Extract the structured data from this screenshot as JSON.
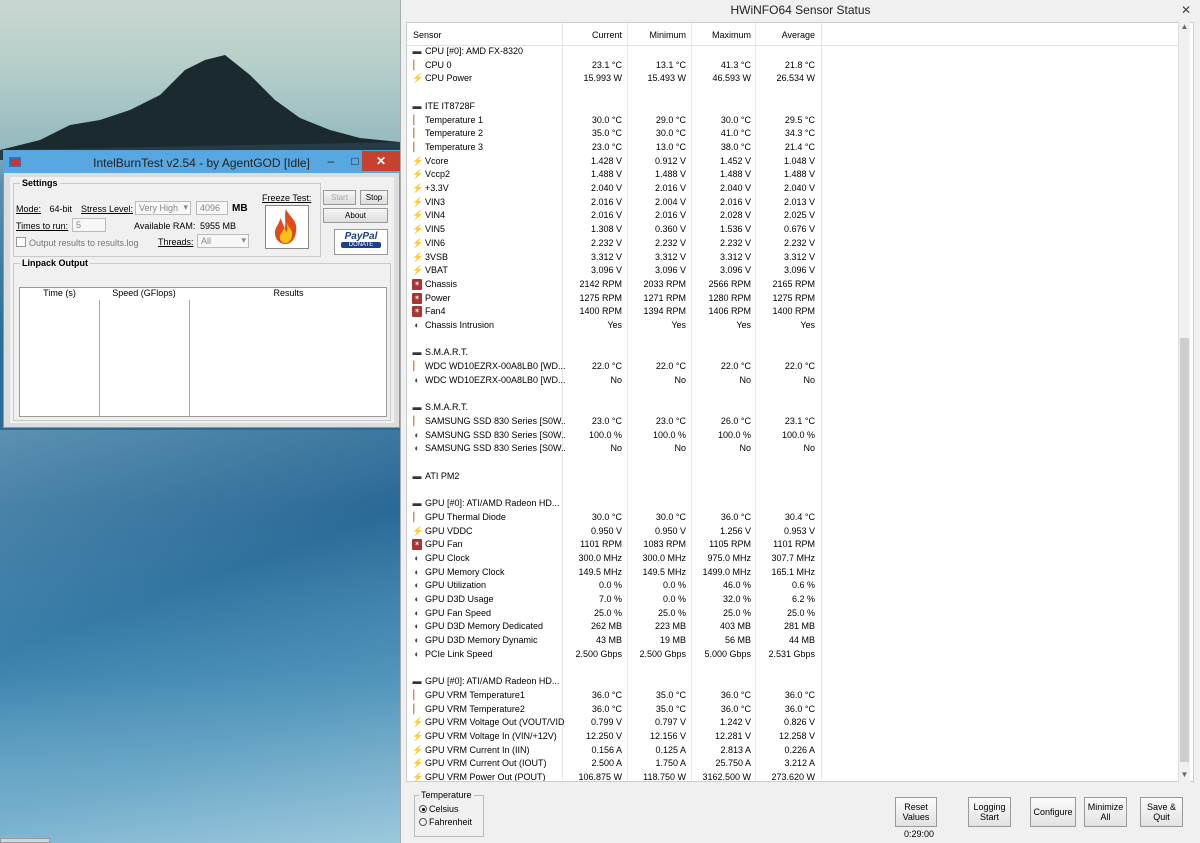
{
  "ibt": {
    "title": "IntelBurnTest v2.54 - by AgentGOD [Idle]",
    "win_min": "–",
    "win_max": "□",
    "win_close": "✕",
    "settings_title": "Settings",
    "mode_label": "Mode:",
    "mode_value": "64-bit",
    "stress_label": "Stress Level:",
    "stress_value": "Very High",
    "mb_value": "4096",
    "mb_unit": "MB",
    "times_label": "Times to run:",
    "times_value": "5",
    "ram_label": "Available RAM:",
    "ram_value": "5955 MB",
    "threads_label": "Threads:",
    "threads_value": "All",
    "log_label": "Output results to results.log",
    "freeze_label": "Freeze Test:",
    "start_label": "Start",
    "stop_label": "Stop",
    "about_label": "About",
    "paypal_label": "PayPal",
    "donate_label": "DONATE",
    "linpack_title": "Linpack Output",
    "col_time": "Time (s)",
    "col_speed": "Speed (GFlops)",
    "col_results": "Results"
  },
  "hw": {
    "title": "HWiNFO64 Sensor Status",
    "close": "✕",
    "headers": {
      "sensor": "Sensor",
      "current": "Current",
      "minimum": "Minimum",
      "maximum": "Maximum",
      "average": "Average"
    },
    "rows": [
      {
        "icon": "grp",
        "name": "CPU [#0]: AMD FX-8320"
      },
      {
        "icon": "temp",
        "name": "CPU 0",
        "cur": "23.1 °C",
        "min": "13.1 °C",
        "max": "41.3 °C",
        "avg": "21.8 °C"
      },
      {
        "icon": "volt",
        "name": "CPU Power",
        "cur": "15.993 W",
        "min": "15.493 W",
        "max": "46.593 W",
        "avg": "26.534 W"
      },
      {
        "icon": "blank",
        "name": ""
      },
      {
        "icon": "grp",
        "name": "ITE IT8728F"
      },
      {
        "icon": "temp",
        "name": "Temperature 1",
        "cur": "30.0 °C",
        "min": "29.0 °C",
        "max": "30.0 °C",
        "avg": "29.5 °C"
      },
      {
        "icon": "temp",
        "name": "Temperature 2",
        "cur": "35.0 °C",
        "min": "30.0 °C",
        "max": "41.0 °C",
        "avg": "34.3 °C"
      },
      {
        "icon": "temp",
        "name": "Temperature 3",
        "cur": "23.0 °C",
        "min": "13.0 °C",
        "max": "38.0 °C",
        "avg": "21.4 °C"
      },
      {
        "icon": "volt",
        "name": "Vcore",
        "cur": "1.428 V",
        "min": "0.912 V",
        "max": "1.452 V",
        "avg": "1.048 V"
      },
      {
        "icon": "volt",
        "name": "Vccp2",
        "cur": "1.488 V",
        "min": "1.488 V",
        "max": "1.488 V",
        "avg": "1.488 V"
      },
      {
        "icon": "volt",
        "name": "+3.3V",
        "cur": "2.040 V",
        "min": "2.016 V",
        "max": "2.040 V",
        "avg": "2.040 V"
      },
      {
        "icon": "volt",
        "name": "VIN3",
        "cur": "2.016 V",
        "min": "2.004 V",
        "max": "2.016 V",
        "avg": "2.013 V"
      },
      {
        "icon": "volt",
        "name": "VIN4",
        "cur": "2.016 V",
        "min": "2.016 V",
        "max": "2.028 V",
        "avg": "2.025 V"
      },
      {
        "icon": "volt",
        "name": "VIN5",
        "cur": "1.308 V",
        "min": "0.360 V",
        "max": "1.536 V",
        "avg": "0.676 V"
      },
      {
        "icon": "volt",
        "name": "VIN6",
        "cur": "2.232 V",
        "min": "2.232 V",
        "max": "2.232 V",
        "avg": "2.232 V"
      },
      {
        "icon": "volt",
        "name": "3VSB",
        "cur": "3.312 V",
        "min": "3.312 V",
        "max": "3.312 V",
        "avg": "3.312 V"
      },
      {
        "icon": "volt",
        "name": "VBAT",
        "cur": "3.096 V",
        "min": "3.096 V",
        "max": "3.096 V",
        "avg": "3.096 V"
      },
      {
        "icon": "fan",
        "name": "Chassis",
        "cur": "2142 RPM",
        "min": "2033 RPM",
        "max": "2566 RPM",
        "avg": "2165 RPM"
      },
      {
        "icon": "fan",
        "name": "Power",
        "cur": "1275 RPM",
        "min": "1271 RPM",
        "max": "1280 RPM",
        "avg": "1275 RPM"
      },
      {
        "icon": "fan",
        "name": "Fan4",
        "cur": "1400 RPM",
        "min": "1394 RPM",
        "max": "1406 RPM",
        "avg": "1400 RPM"
      },
      {
        "icon": "gen",
        "name": "Chassis Intrusion",
        "cur": "Yes",
        "min": "Yes",
        "max": "Yes",
        "avg": "Yes"
      },
      {
        "icon": "blank",
        "name": ""
      },
      {
        "icon": "grp",
        "name": "S.M.A.R.T."
      },
      {
        "icon": "temp",
        "name": "WDC WD10EZRX-00A8LB0 [WD...",
        "cur": "22.0 °C",
        "min": "22.0 °C",
        "max": "22.0 °C",
        "avg": "22.0 °C"
      },
      {
        "icon": "gen",
        "name": "WDC WD10EZRX-00A8LB0 [WD...",
        "cur": "No",
        "min": "No",
        "max": "No",
        "avg": "No"
      },
      {
        "icon": "blank",
        "name": ""
      },
      {
        "icon": "grp",
        "name": "S.M.A.R.T."
      },
      {
        "icon": "temp",
        "name": "SAMSUNG SSD 830 Series [S0W...",
        "cur": "23.0 °C",
        "min": "23.0 °C",
        "max": "26.0 °C",
        "avg": "23.1 °C"
      },
      {
        "icon": "gen",
        "name": "SAMSUNG SSD 830 Series [S0W...",
        "cur": "100.0 %",
        "min": "100.0 %",
        "max": "100.0 %",
        "avg": "100.0 %"
      },
      {
        "icon": "gen",
        "name": "SAMSUNG SSD 830 Series [S0W...",
        "cur": "No",
        "min": "No",
        "max": "No",
        "avg": "No"
      },
      {
        "icon": "blank",
        "name": ""
      },
      {
        "icon": "grp",
        "name": "ATI PM2"
      },
      {
        "icon": "blank",
        "name": ""
      },
      {
        "icon": "grp",
        "name": "GPU [#0]: ATI/AMD Radeon HD..."
      },
      {
        "icon": "temp",
        "name": "GPU Thermal Diode",
        "cur": "30.0 °C",
        "min": "30.0 °C",
        "max": "36.0 °C",
        "avg": "30.4 °C"
      },
      {
        "icon": "volt",
        "name": "GPU VDDC",
        "cur": "0.950 V",
        "min": "0.950 V",
        "max": "1.256 V",
        "avg": "0.953 V"
      },
      {
        "icon": "fan",
        "name": "GPU Fan",
        "cur": "1101 RPM",
        "min": "1083 RPM",
        "max": "1105 RPM",
        "avg": "1101 RPM"
      },
      {
        "icon": "gen",
        "name": "GPU Clock",
        "cur": "300.0 MHz",
        "min": "300.0 MHz",
        "max": "975.0 MHz",
        "avg": "307.7 MHz"
      },
      {
        "icon": "gen",
        "name": "GPU Memory Clock",
        "cur": "149.5 MHz",
        "min": "149.5 MHz",
        "max": "1499.0 MHz",
        "avg": "165.1 MHz"
      },
      {
        "icon": "gen",
        "name": "GPU Utilization",
        "cur": "0.0 %",
        "min": "0.0 %",
        "max": "46.0 %",
        "avg": "0.6 %"
      },
      {
        "icon": "gen",
        "name": "GPU D3D Usage",
        "cur": "7.0 %",
        "min": "0.0 %",
        "max": "32.0 %",
        "avg": "6.2 %"
      },
      {
        "icon": "gen",
        "name": "GPU Fan Speed",
        "cur": "25.0 %",
        "min": "25.0 %",
        "max": "25.0 %",
        "avg": "25.0 %"
      },
      {
        "icon": "gen",
        "name": "GPU D3D Memory Dedicated",
        "cur": "262 MB",
        "min": "223 MB",
        "max": "403 MB",
        "avg": "281 MB"
      },
      {
        "icon": "gen",
        "name": "GPU D3D Memory Dynamic",
        "cur": "43 MB",
        "min": "19 MB",
        "max": "56 MB",
        "avg": "44 MB"
      },
      {
        "icon": "gen",
        "name": "PCIe Link Speed",
        "cur": "2.500 Gbps",
        "min": "2.500 Gbps",
        "max": "5.000 Gbps",
        "avg": "2.531 Gbps"
      },
      {
        "icon": "blank",
        "name": ""
      },
      {
        "icon": "grp",
        "name": "GPU [#0]: ATI/AMD Radeon HD..."
      },
      {
        "icon": "temp",
        "name": "GPU VRM Temperature1",
        "cur": "36.0 °C",
        "min": "35.0 °C",
        "max": "36.0 °C",
        "avg": "36.0 °C"
      },
      {
        "icon": "temp",
        "name": "GPU VRM Temperature2",
        "cur": "36.0 °C",
        "min": "35.0 °C",
        "max": "36.0 °C",
        "avg": "36.0 °C"
      },
      {
        "icon": "volt",
        "name": "GPU VRM Voltage Out (VOUT/VID)",
        "cur": "0.799 V",
        "min": "0.797 V",
        "max": "1.242 V",
        "avg": "0.826 V"
      },
      {
        "icon": "volt",
        "name": "GPU VRM Voltage In (VIN/+12V)",
        "cur": "12.250 V",
        "min": "12.156 V",
        "max": "12.281 V",
        "avg": "12.258 V"
      },
      {
        "icon": "volt",
        "name": "GPU VRM Current In (IIN)",
        "cur": "0.156 A",
        "min": "0.125 A",
        "max": "2.813 A",
        "avg": "0.226 A"
      },
      {
        "icon": "volt",
        "name": "GPU VRM Current Out (IOUT)",
        "cur": "2.500 A",
        "min": "1.750 A",
        "max": "25.750 A",
        "avg": "3.212 A"
      },
      {
        "icon": "volt",
        "name": "GPU VRM Power Out (POUT)",
        "cur": "106.875 W",
        "min": "118.750 W",
        "max": "3162.500 W",
        "avg": "273.620 W"
      }
    ],
    "temp_group_title": "Temperature",
    "celsius": "Celsius",
    "fahrenheit": "Fahrenheit",
    "reset_label": "Reset Values",
    "logging_label": "Logging Start",
    "configure_label": "Configure",
    "minimize_label": "Minimize All",
    "save_label": "Save & Quit",
    "timer": "0:29:00"
  }
}
